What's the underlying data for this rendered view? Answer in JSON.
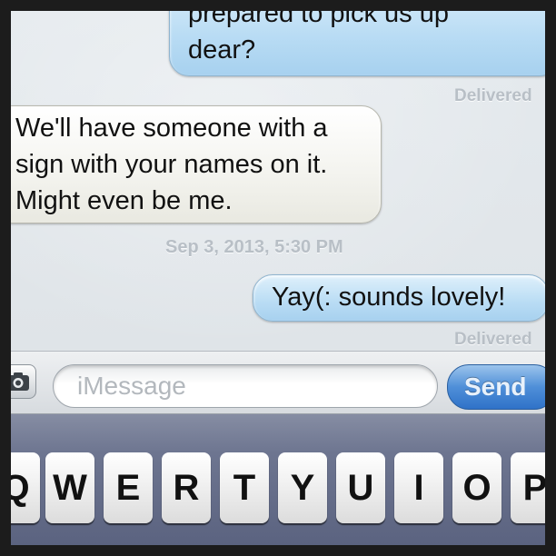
{
  "messages": [
    {
      "direction": "outgoing",
      "text_lines": [
        "prepared to pick us up",
        "dear?"
      ],
      "status": "Delivered"
    },
    {
      "direction": "incoming",
      "text_lines": [
        "We'll have someone with a",
        "sign with your names on it.",
        "Might even be me."
      ]
    },
    {
      "direction": "outgoing",
      "text_lines": [
        "Yay(: sounds lovely!"
      ],
      "status": "Delivered"
    }
  ],
  "timestamp": "Sep 3, 2013, 5:30 PM",
  "composer": {
    "placeholder": "iMessage",
    "send_label": "Send",
    "camera_icon": "camera-icon"
  },
  "keyboard": {
    "row1": [
      "Q",
      "W",
      "E",
      "R",
      "T",
      "Y",
      "U",
      "I",
      "O",
      "P"
    ]
  },
  "colors": {
    "outgoing_bubble": "#b9dcf4",
    "incoming_bubble": "#f3f3ee",
    "send_button": "#4f8fd8",
    "keyboard_bg": "#6d7590"
  }
}
